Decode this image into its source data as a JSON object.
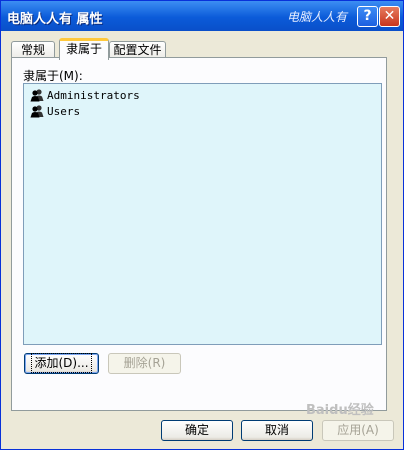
{
  "window": {
    "title": "电脑人人有 属性",
    "watermark": "电脑人人有"
  },
  "titlebar_buttons": {
    "help": "?",
    "close": "✕"
  },
  "tabs": [
    {
      "label": "常规"
    },
    {
      "label": "隶属于"
    },
    {
      "label": "配置文件"
    }
  ],
  "member_of": {
    "label": "隶属于(M):",
    "items": [
      {
        "name": "Administrators",
        "icon": "user-group-icon"
      },
      {
        "name": "Users",
        "icon": "user-group-icon"
      }
    ]
  },
  "buttons": {
    "add": "添加(D)...",
    "remove": "删除(R)",
    "ok": "确定",
    "cancel": "取消",
    "apply": "应用(A)"
  },
  "site_watermark": "Baidu经验",
  "colors": {
    "title_bar": "#0b5bd9",
    "list_bg": "#dff5fa",
    "tab_accent": "#ffc83c",
    "close_red": "#c9351c"
  }
}
